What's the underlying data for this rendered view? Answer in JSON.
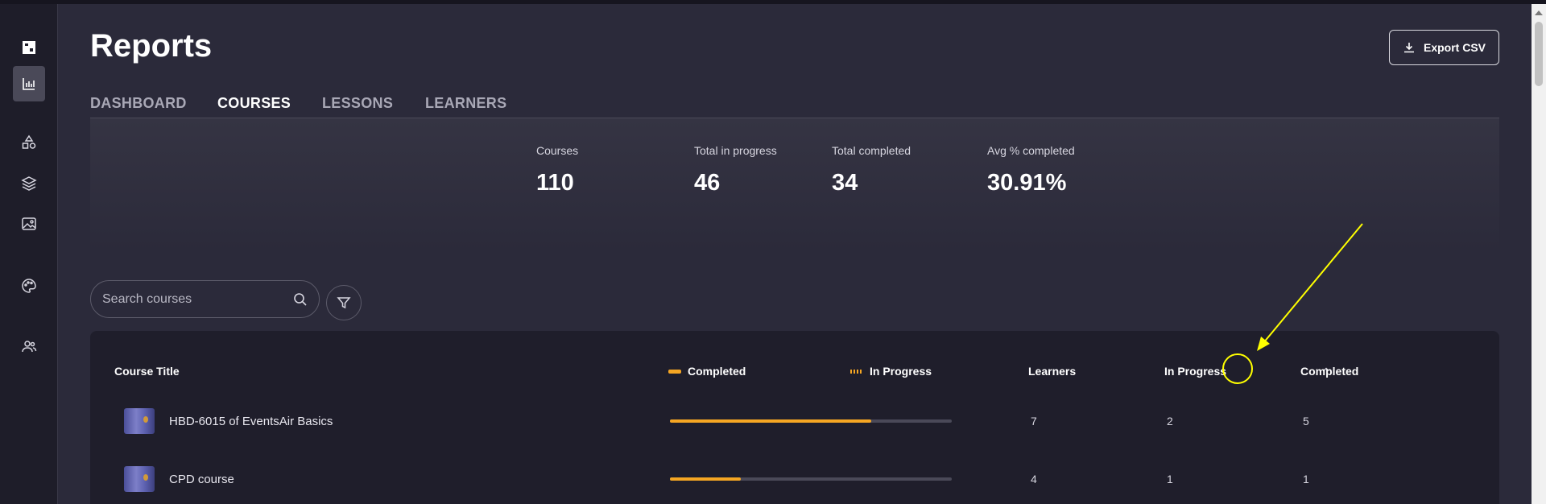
{
  "sidebar": {
    "icons": [
      "dashboard-icon",
      "reports-chart-icon",
      "shapes-icon",
      "layers-icon",
      "image-icon",
      "palette-icon",
      "users-icon"
    ]
  },
  "page": {
    "title": "Reports",
    "export_label": "Export CSV"
  },
  "tabs": [
    {
      "label": "DASHBOARD",
      "active": false
    },
    {
      "label": "COURSES",
      "active": true
    },
    {
      "label": "LESSONS",
      "active": false
    },
    {
      "label": "LEARNERS",
      "active": false
    }
  ],
  "stats": [
    {
      "label": "Courses",
      "value": "110"
    },
    {
      "label": "Total in progress",
      "value": "46"
    },
    {
      "label": "Total completed",
      "value": "34"
    },
    {
      "label": "Avg % completed",
      "value": "30.91%"
    }
  ],
  "search": {
    "placeholder": "Search courses"
  },
  "table": {
    "headers": {
      "course_title": "Course Title",
      "legend_completed": "Completed",
      "legend_in_progress": "In Progress",
      "learners": "Learners",
      "in_progress": "In Progress",
      "completed": "Completed"
    },
    "rows": [
      {
        "title": "HBD-6015 of EventsAir Basics",
        "progress": 0.714,
        "learners": "7",
        "in_progress": "2",
        "completed": "5"
      },
      {
        "title": "CPD course",
        "progress": 0.25,
        "learners": "4",
        "in_progress": "1",
        "completed": "1"
      }
    ]
  },
  "colors": {
    "accent": "#f5a623",
    "background": "#2b2a3a",
    "sidebar": "#1e1d29",
    "table": "#1f1e2b",
    "annotation": "#ffff00"
  }
}
